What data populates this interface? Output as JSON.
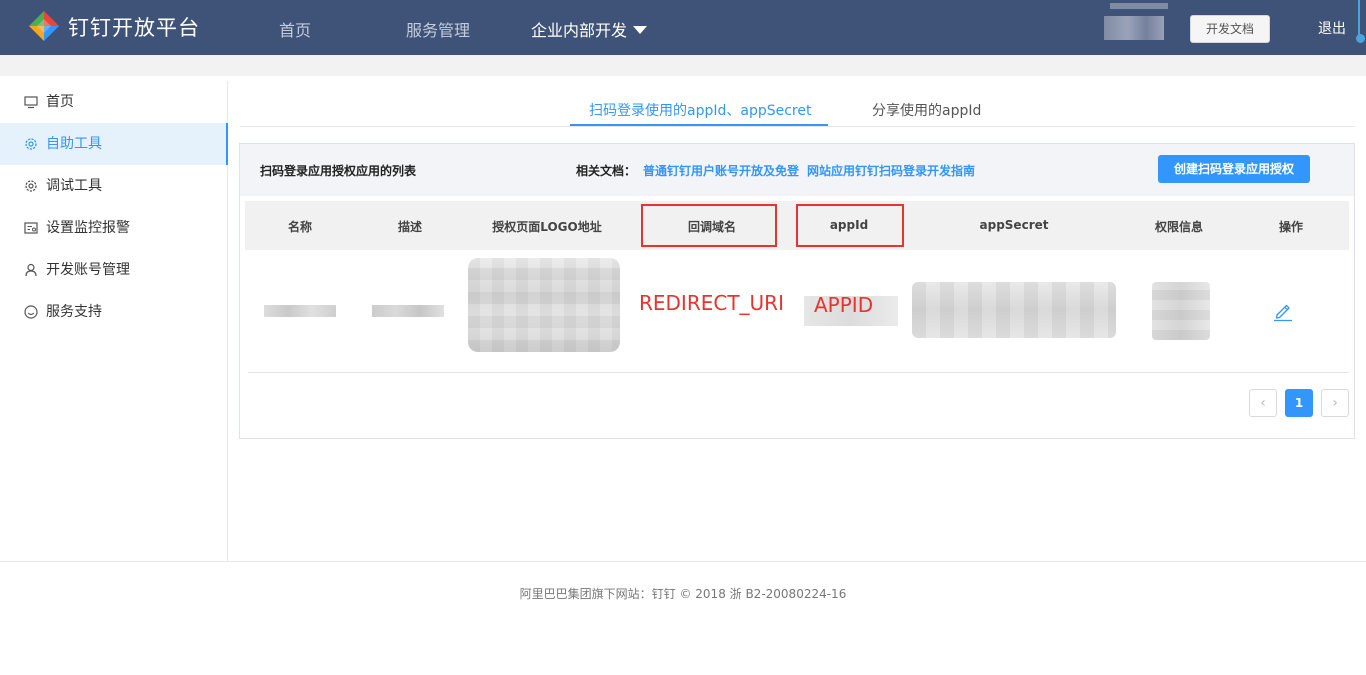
{
  "header": {
    "brand": "钉钉开放平台",
    "nav": [
      {
        "label": "首页"
      },
      {
        "label": "服务管理"
      },
      {
        "label": "企业内部开发"
      }
    ],
    "dev_docs_button": "开发文档",
    "logout": "退出"
  },
  "sidebar": {
    "items": [
      {
        "label": "首页",
        "icon": "monitor-icon"
      },
      {
        "label": "自助工具",
        "icon": "gear-icon",
        "active": true
      },
      {
        "label": "调试工具",
        "icon": "gear-icon"
      },
      {
        "label": "设置监控报警",
        "icon": "alarm-icon"
      },
      {
        "label": "开发账号管理",
        "icon": "user-icon"
      },
      {
        "label": "服务支持",
        "icon": "smile-icon"
      }
    ]
  },
  "tabs": [
    {
      "label": "扫码登录使用的appId、appSecret",
      "active": true
    },
    {
      "label": "分享使用的appId"
    }
  ],
  "panel": {
    "title": "扫码登录应用授权应用的列表",
    "docs_label": "相关文档：",
    "doc_links": [
      "普通钉钉用户账号开放及免登",
      "网站应用钉钉扫码登录开发指南"
    ],
    "create_button": "创建扫码登录应用授权"
  },
  "table": {
    "columns": [
      "名称",
      "描述",
      "授权页面LOGO地址",
      "回调域名",
      "appId",
      "appSecret",
      "权限信息",
      "操作"
    ]
  },
  "annotations": {
    "redirect_uri": "REDIRECT_URI",
    "appid": "APPID"
  },
  "pagination": {
    "prev": "‹",
    "current": "1",
    "next": "›"
  },
  "footer": {
    "text": "阿里巴巴集团旗下网站：钉钉 © 2018 浙 B2-20080224-16"
  },
  "colors": {
    "topbar": "#3f5278",
    "accent": "#3296fa",
    "annotation_red": "#e8342e"
  }
}
